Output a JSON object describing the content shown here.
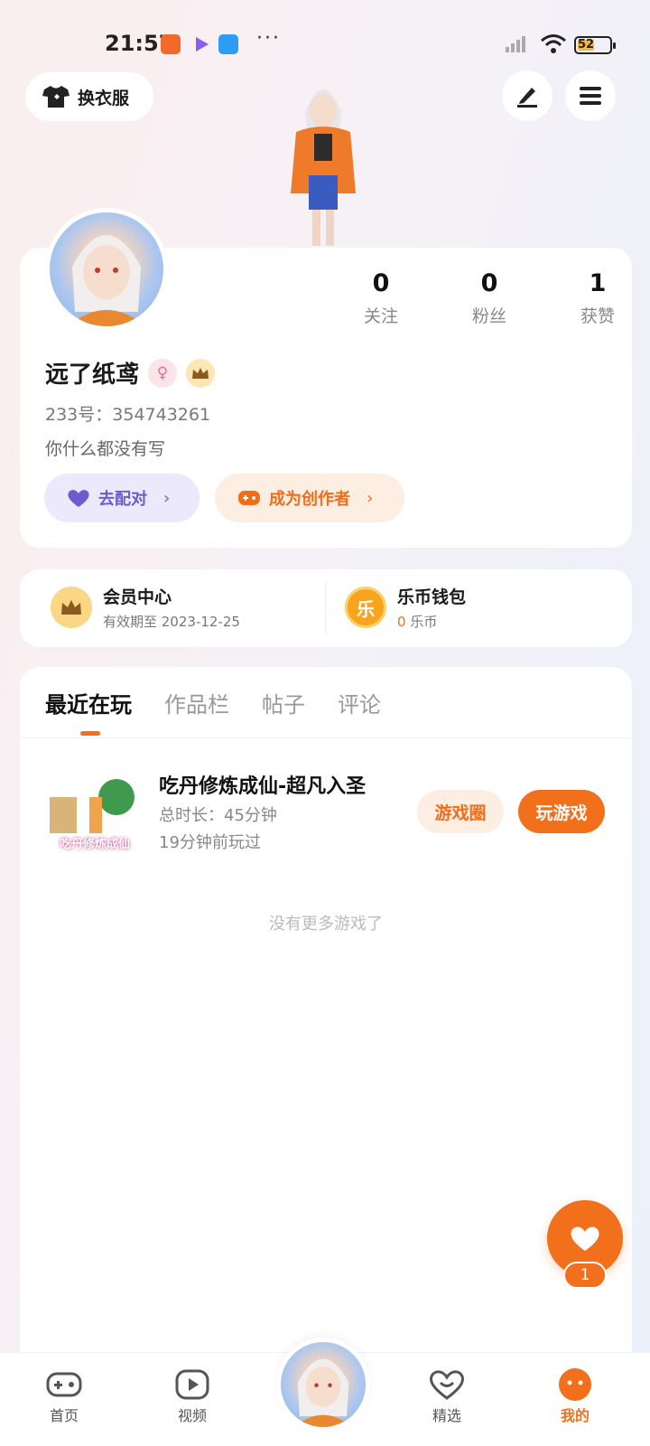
{
  "status_bar": {
    "time": "21:57",
    "battery": "52",
    "battery_level": 0.52
  },
  "header": {
    "wardrobe_label": "换衣服"
  },
  "profile": {
    "stats": [
      {
        "value": "0",
        "label": "关注"
      },
      {
        "value": "0",
        "label": "粉丝"
      },
      {
        "value": "1",
        "label": "获赞"
      }
    ],
    "name": "远了纸鸢",
    "uid": "233号：354743261",
    "bio": "你什么都没有写",
    "match_label": "去配对",
    "creator_label": "成为创作者"
  },
  "vip": {
    "title": "会员中心",
    "subtitle": "有效期至 2023-12-25",
    "wallet_title": "乐币钱包",
    "wallet_amount": "0",
    "wallet_unit": "乐币",
    "coin_char": "乐"
  },
  "tabs": [
    "最近在玩",
    "作品栏",
    "帖子",
    "评论"
  ],
  "recent_game": {
    "name": "吃丹修炼成仙-超凡入圣",
    "duration": "总时长：45分钟",
    "last_played": "19分钟前玩过",
    "thumb_text": "吃丹修炼成仙",
    "circle_label": "游戏圈",
    "play_label": "玩游戏"
  },
  "no_more": "没有更多游戏了",
  "fab": {
    "count": "1"
  },
  "nav": {
    "home": "首页",
    "video": "视频",
    "featured": "精选",
    "mine": "我的"
  },
  "colors": {
    "accent": "#f26f1b",
    "match": "#6b5ccf"
  },
  "icons": [
    "tshirt-icon",
    "pen-icon",
    "menu-icon",
    "heart-icon",
    "crown-icon",
    "female-icon",
    "gamepad-icon",
    "chevron-right-icon",
    "play-icon",
    "smile-icon"
  ]
}
